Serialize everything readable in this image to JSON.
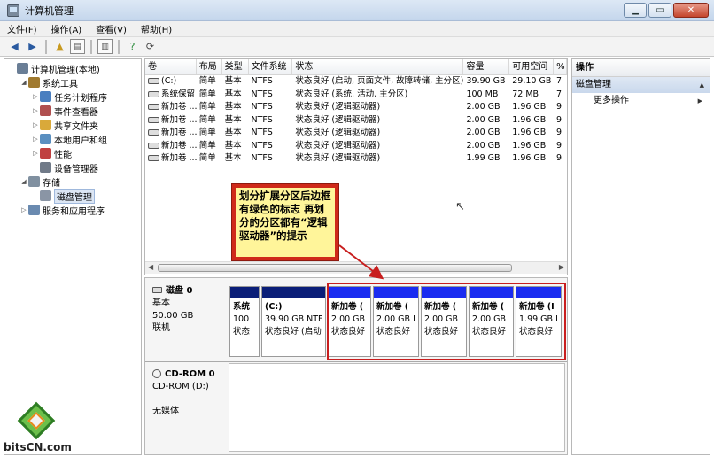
{
  "window": {
    "title": "计算机管理"
  },
  "menu": [
    "文件(F)",
    "操作(A)",
    "查看(V)",
    "帮助(H)"
  ],
  "tree": [
    {
      "label": "计算机管理(本地)",
      "indent": 0,
      "exp": "",
      "icon": "computer-icon"
    },
    {
      "label": "系统工具",
      "indent": 1,
      "exp": "◢",
      "icon": "tools-icon"
    },
    {
      "label": "任务计划程序",
      "indent": 2,
      "exp": "▷",
      "icon": "clock-icon"
    },
    {
      "label": "事件查看器",
      "indent": 2,
      "exp": "▷",
      "icon": "event-icon"
    },
    {
      "label": "共享文件夹",
      "indent": 2,
      "exp": "▷",
      "icon": "folder-icon"
    },
    {
      "label": "本地用户和组",
      "indent": 2,
      "exp": "▷",
      "icon": "users-icon"
    },
    {
      "label": "性能",
      "indent": 2,
      "exp": "▷",
      "icon": "performance-icon"
    },
    {
      "label": "设备管理器",
      "indent": 2,
      "exp": "",
      "icon": "device-icon"
    },
    {
      "label": "存储",
      "indent": 1,
      "exp": "◢",
      "icon": "storage-icon"
    },
    {
      "label": "磁盘管理",
      "indent": 2,
      "exp": "",
      "icon": "disk-icon",
      "selected": true
    },
    {
      "label": "服务和应用程序",
      "indent": 1,
      "exp": "▷",
      "icon": "services-icon"
    }
  ],
  "volumes": {
    "headers": [
      "卷",
      "布局",
      "类型",
      "文件系统",
      "状态",
      "容量",
      "可用空间",
      "%"
    ],
    "rows": [
      [
        "(C:)",
        "简单",
        "基本",
        "NTFS",
        "状态良好 (启动, 页面文件, 故障转储, 主分区)",
        "39.90 GB",
        "29.10 GB",
        "7"
      ],
      [
        "系统保留",
        "简单",
        "基本",
        "NTFS",
        "状态良好 (系统, 活动, 主分区)",
        "100 MB",
        "72 MB",
        "7"
      ],
      [
        "新加卷 ...",
        "简单",
        "基本",
        "NTFS",
        "状态良好 (逻辑驱动器)",
        "2.00 GB",
        "1.96 GB",
        "9"
      ],
      [
        "新加卷 ...",
        "简单",
        "基本",
        "NTFS",
        "状态良好 (逻辑驱动器)",
        "2.00 GB",
        "1.96 GB",
        "9"
      ],
      [
        "新加卷 ...",
        "简单",
        "基本",
        "NTFS",
        "状态良好 (逻辑驱动器)",
        "2.00 GB",
        "1.96 GB",
        "9"
      ],
      [
        "新加卷 ...",
        "简单",
        "基本",
        "NTFS",
        "状态良好 (逻辑驱动器)",
        "2.00 GB",
        "1.96 GB",
        "9"
      ],
      [
        "新加卷 ...",
        "简单",
        "基本",
        "NTFS",
        "状态良好 (逻辑驱动器)",
        "1.99 GB",
        "1.96 GB",
        "9"
      ]
    ]
  },
  "disk0": {
    "name": "磁盘 0",
    "type": "基本",
    "size": "50.00 GB",
    "status": "联机",
    "partitions": [
      {
        "name": "系统",
        "size": "100",
        "status": "状态",
        "logical": false
      },
      {
        "name": "(C:)",
        "size": "39.90 GB NTF",
        "status": "状态良好 (启动",
        "logical": false
      },
      {
        "name": "新加卷 (",
        "size": "2.00 GB",
        "status": "状态良好",
        "logical": true
      },
      {
        "name": "新加卷 (",
        "size": "2.00 GB I",
        "status": "状态良好",
        "logical": true
      },
      {
        "name": "新加卷 (",
        "size": "2.00 GB I",
        "status": "状态良好",
        "logical": true
      },
      {
        "name": "新加卷 (",
        "size": "2.00 GB",
        "status": "状态良好",
        "logical": true
      },
      {
        "name": "新加卷 (I",
        "size": "1.99 GB I",
        "status": "状态良好",
        "logical": true
      }
    ]
  },
  "cdrom": {
    "name": "CD-ROM 0",
    "drive": "CD-ROM (D:)",
    "media": "无媒体"
  },
  "callout": {
    "text": "划分扩展分区后边框有绿色的标志 再划分的分区都有“逻辑驱动器”的提示"
  },
  "actions": {
    "header": "操作",
    "section": "磁盘管理",
    "more": "更多操作"
  },
  "watermark": {
    "text": "bitsCN.com"
  }
}
